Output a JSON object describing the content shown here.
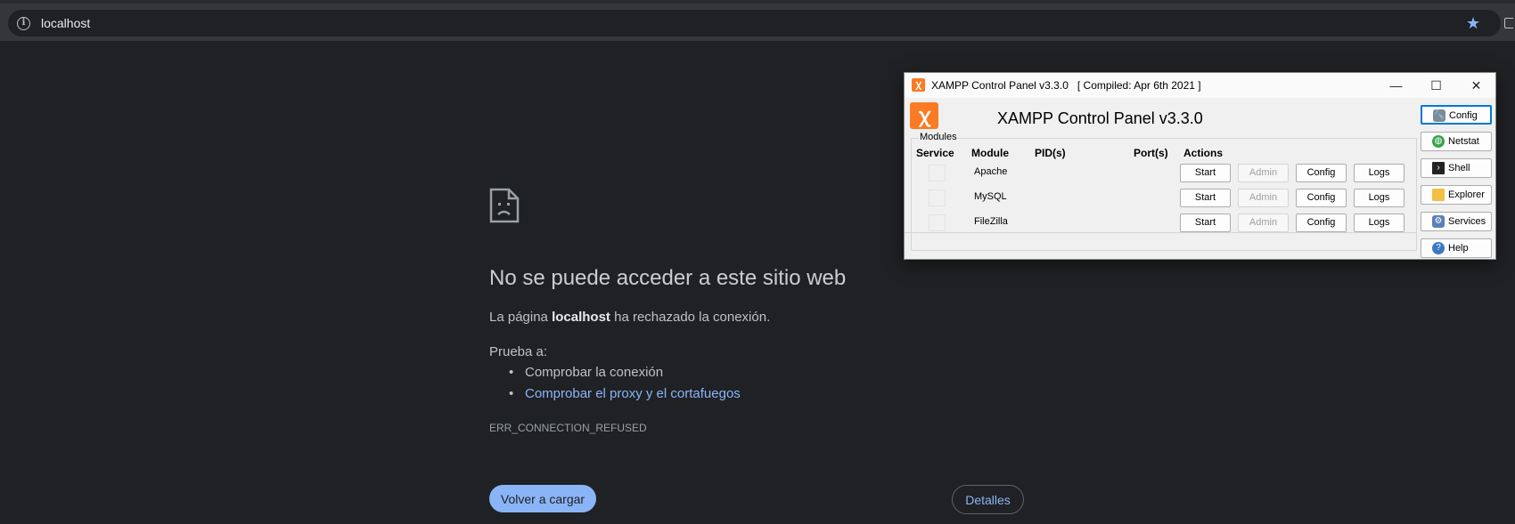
{
  "browser": {
    "url": "localhost"
  },
  "error_page": {
    "title": "No se puede acceder a este sitio web",
    "message_prefix": "La página",
    "message_host": "localhost",
    "message_suffix": "ha rechazado la conexión.",
    "try_label": "Prueba a:",
    "suggestions": [
      "Comprobar la conexión",
      "Comprobar el proxy y el cortafuegos"
    ],
    "error_code": "ERR_CONNECTION_REFUSED",
    "reload_label": "Volver a cargar",
    "details_label": "Detalles"
  },
  "xampp": {
    "window_title": "XAMPP Control Panel v3.3.0   [ Compiled: Apr 6th 2021 ]",
    "heading": "XAMPP Control Panel v3.3.0",
    "modules_label": "Modules",
    "headers": {
      "service": "Service",
      "module": "Module",
      "pids": "PID(s)",
      "ports": "Port(s)",
      "actions": "Actions"
    },
    "rows": [
      {
        "module": "Apache",
        "start": "Start",
        "admin": "Admin",
        "config": "Config",
        "logs": "Logs"
      },
      {
        "module": "MySQL",
        "start": "Start",
        "admin": "Admin",
        "config": "Config",
        "logs": "Logs"
      },
      {
        "module": "FileZilla",
        "start": "Start",
        "admin": "Admin",
        "config": "Config",
        "logs": "Logs"
      }
    ],
    "side_buttons": {
      "config": "Config",
      "netstat": "Netstat",
      "shell": "Shell",
      "explorer": "Explorer",
      "services": "Services",
      "help": "Help"
    },
    "controls": {
      "minimize": "—",
      "maximize": "☐",
      "close": "✕"
    }
  },
  "colors": {
    "page_bg": "#202124",
    "link": "#8ab4f8",
    "xampp_orange": "#fb7a24"
  }
}
